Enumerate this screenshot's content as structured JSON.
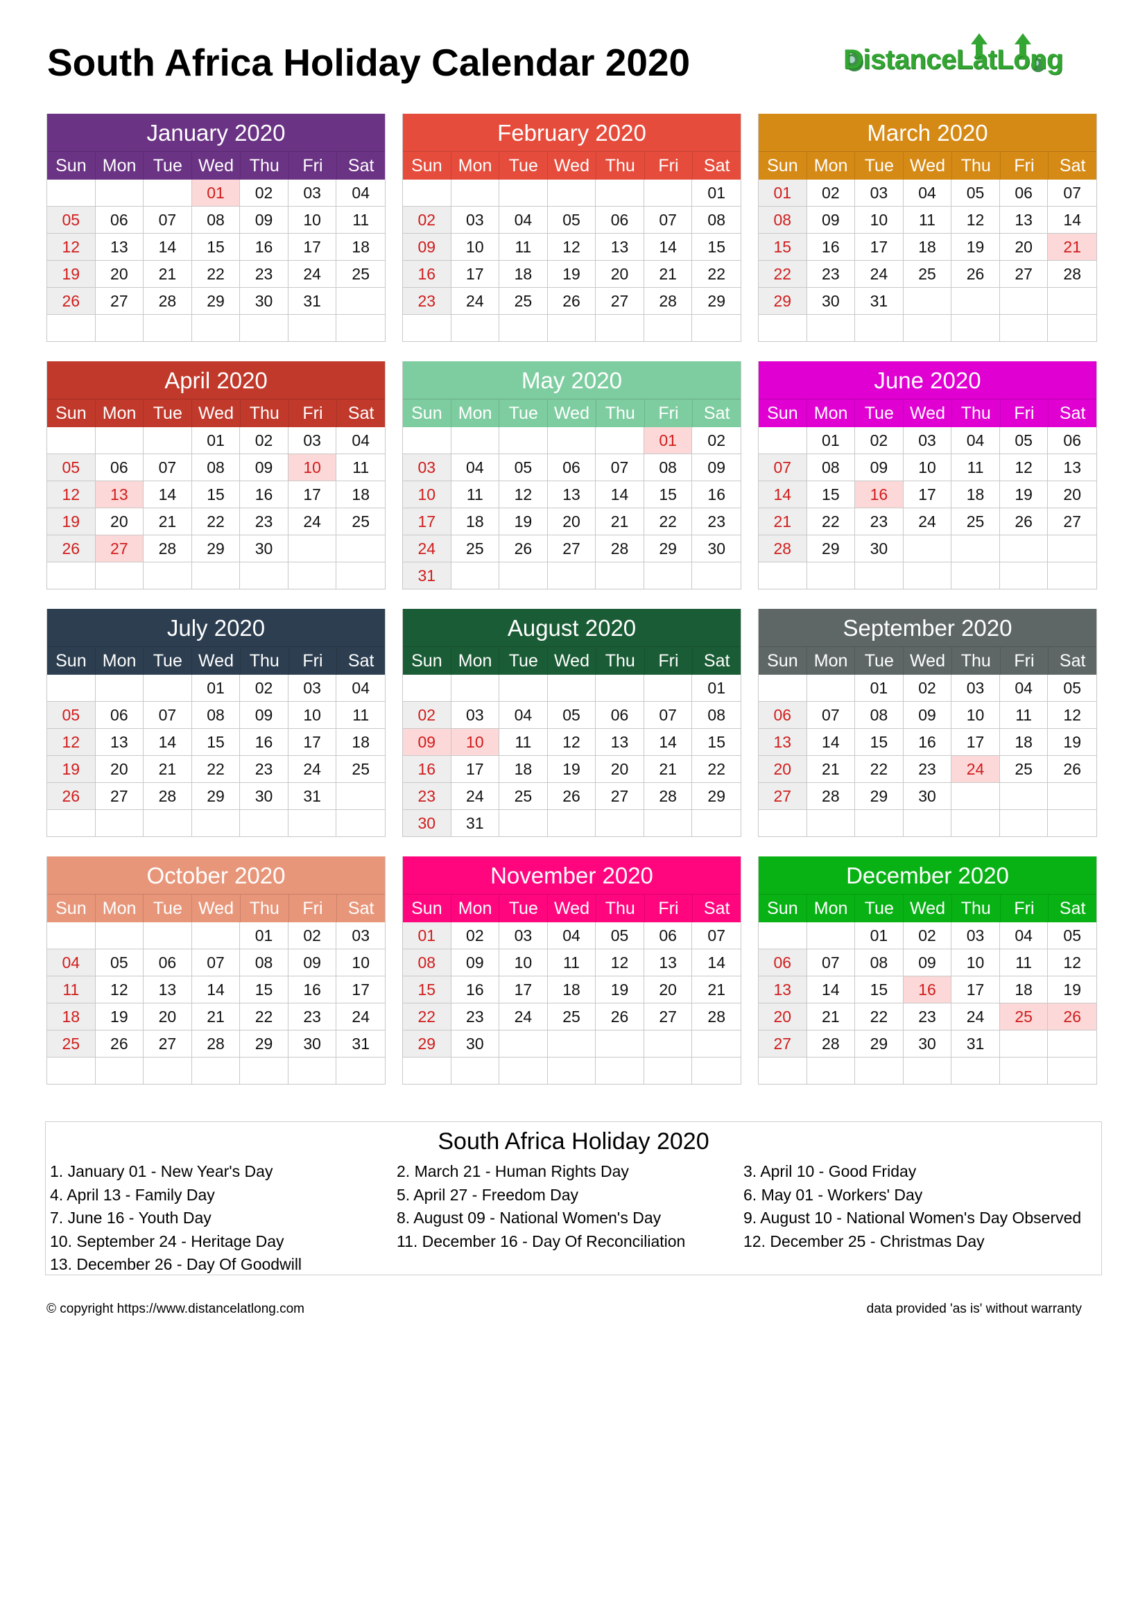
{
  "header": {
    "title": "South Africa Holiday Calendar 2020",
    "logo_text": "DistanceLatLong"
  },
  "weekday_labels": [
    "Sun",
    "Mon",
    "Tue",
    "Wed",
    "Thu",
    "Fri",
    "Sat"
  ],
  "colors": {
    "sunday_text": "#d01c1c",
    "sunday_bg": "#eeeeee",
    "holiday_bg": "#fcd8d8",
    "logo_green": "#33a532"
  },
  "months": [
    {
      "title": "January 2020",
      "color": "#6a3384",
      "first_weekday": 3,
      "days": 31,
      "holidays": [
        1
      ]
    },
    {
      "title": "February 2020",
      "color": "#e64c3c",
      "first_weekday": 6,
      "days": 29,
      "holidays": []
    },
    {
      "title": "March 2020",
      "color": "#d68a16",
      "first_weekday": 0,
      "days": 31,
      "holidays": [
        21
      ]
    },
    {
      "title": "April 2020",
      "color": "#c0392b",
      "first_weekday": 3,
      "days": 30,
      "holidays": [
        10,
        13,
        27
      ]
    },
    {
      "title": "May 2020",
      "color": "#7ecda0",
      "first_weekday": 5,
      "days": 31,
      "holidays": [
        1
      ]
    },
    {
      "title": "June 2020",
      "color": "#e000d2",
      "first_weekday": 1,
      "days": 30,
      "holidays": [
        16
      ]
    },
    {
      "title": "July 2020",
      "color": "#2c3e50",
      "first_weekday": 3,
      "days": 31,
      "holidays": []
    },
    {
      "title": "August 2020",
      "color": "#1a5c35",
      "first_weekday": 6,
      "days": 31,
      "holidays": [
        9,
        10
      ]
    },
    {
      "title": "September 2020",
      "color": "#5e6766",
      "first_weekday": 2,
      "days": 30,
      "holidays": [
        24
      ]
    },
    {
      "title": "October 2020",
      "color": "#e8967a",
      "first_weekday": 4,
      "days": 31,
      "holidays": []
    },
    {
      "title": "November 2020",
      "color": "#ff057e",
      "first_weekday": 0,
      "days": 30,
      "holidays": []
    },
    {
      "title": "December 2020",
      "color": "#08b215",
      "first_weekday": 2,
      "days": 31,
      "holidays": [
        16,
        25,
        26
      ]
    }
  ],
  "holiday_section": {
    "title": "South Africa Holiday 2020",
    "items": [
      "1. January 01 - New Year's Day",
      "2. March 21 - Human Rights Day",
      "3. April 10 - Good Friday",
      "4. April 13 - Family Day",
      "5. April 27 - Freedom Day",
      "6. May 01 - Workers' Day",
      "7. June 16 - Youth Day",
      "8. August 09 - National Women's Day",
      "9. August 10 - National Women's Day Observed",
      "10. September 24 - Heritage Day",
      "11. December 16 - Day Of Reconciliation",
      "12. December 25 - Christmas Day",
      "13. December 26 - Day Of Goodwill"
    ]
  },
  "footer": {
    "copyright": "© copyright https://www.distancelatlong.com",
    "disclaimer": "data provided 'as is' without warranty"
  }
}
